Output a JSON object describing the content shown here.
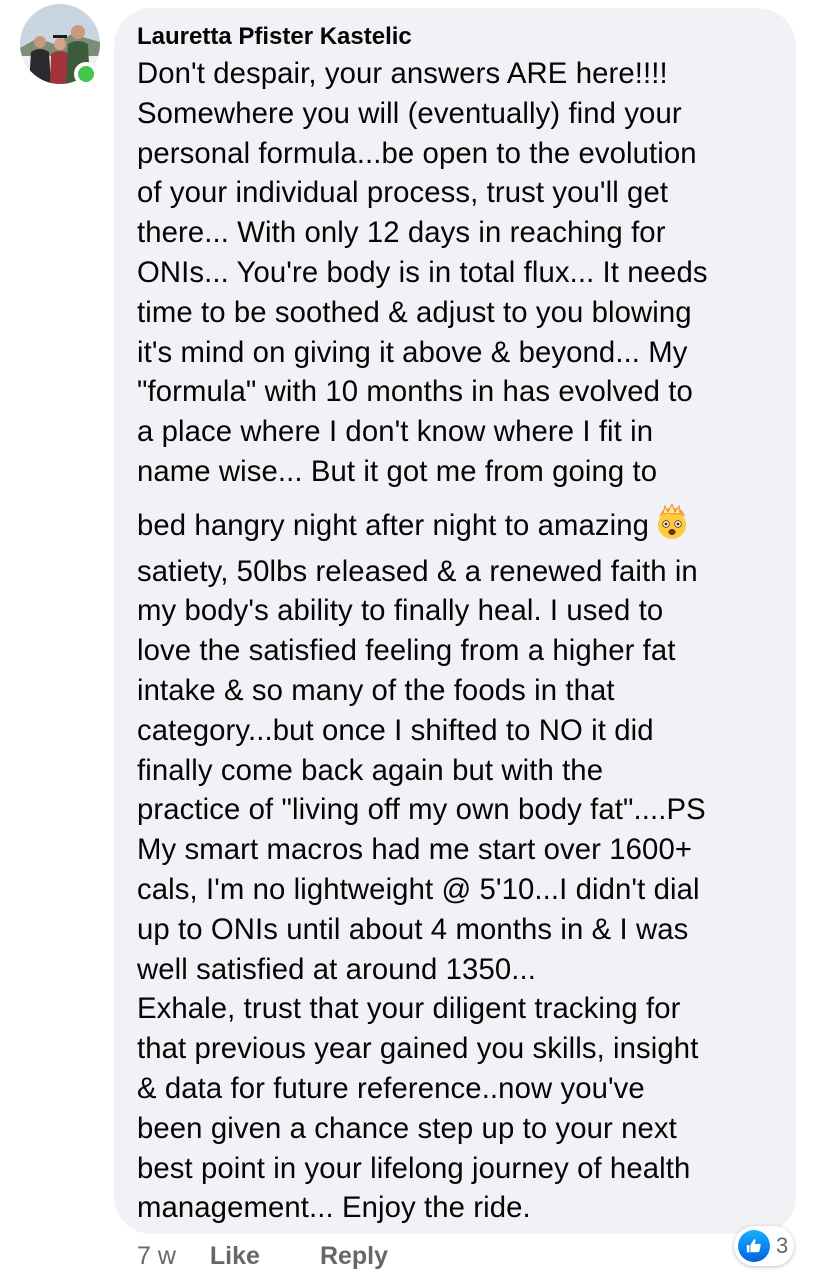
{
  "comment": {
    "author": "Lauretta Pfister Kastelic",
    "text_part1": "Don't despair, your answers ARE here!!!!\nSomewhere you will (eventually) find your\npersonal formula...be open to the evolution\nof your individual process, trust you'll get\nthere... With only 12 days in reaching for\nONIs... You're body is in total flux... It needs\ntime to be soothed & adjust to you blowing\nit's mind on giving it above & beyond... My\n\"formula\" with 10 months in has evolved to\na place where I don't know where I fit in\nname wise... But it got me from going to",
    "text_part2": "bed hangry night after night to amazing",
    "text_part3": "satiety, 50lbs released & a renewed faith in\nmy body's ability to finally heal. I used to\nlove the satisfied feeling from a higher fat\nintake & so many of the foods in that\ncategory...but once I shifted to NO it did\nfinally come back again but with the\npractice of \"living off my own body fat\"....PS\nMy smart macros had me start over 1600+\ncals, I'm no lightweight @ 5'10...I didn't dial\nup to ONIs until about 4 months in & I was\nwell satisfied at around 1350...\nExhale, trust that your diligent tracking for\nthat previous year gained you skills, insight\n& data for future reference..now you've\nbeen given a chance step up to your next\nbest point in your lifelong journey of health\nmanagement... Enjoy the ride.",
    "emoji": "exploding-head",
    "author_online": true
  },
  "actions": {
    "time": "7 w",
    "like_label": "Like",
    "reply_label": "Reply"
  },
  "reactions": {
    "type": "like",
    "count": "3"
  },
  "colors": {
    "bubble_bg": "#f0f2f5",
    "text": "#050505",
    "secondary_text": "#65676b",
    "online": "#43c64a",
    "like_blue": "#1877f2"
  }
}
